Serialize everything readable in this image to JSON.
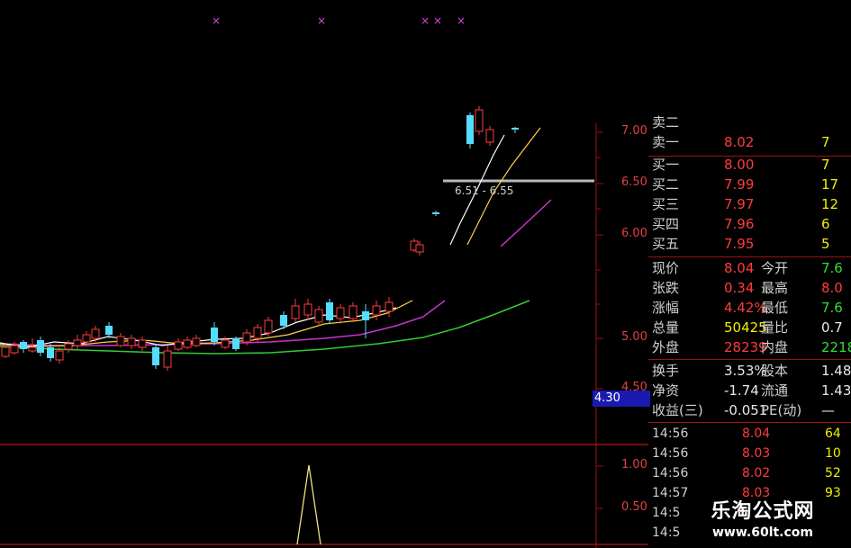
{
  "colors": {
    "up": "#ff3c3c",
    "down": "#55ddff",
    "ma5": "#ffffff",
    "ma10": "#ffd24a",
    "ma20": "#cc33cc",
    "ma60": "#33cc33",
    "grid": "#a01010"
  },
  "signal_icons": [
    "x-mark-icon",
    "x-mark-icon",
    "x-mark-icon",
    "x-mark-icon",
    "x-mark-icon"
  ],
  "signal_glyph": "×",
  "price_axis": [
    "7.00",
    "6.50",
    "6.00",
    "5.00",
    "4.50"
  ],
  "cursor_price": "4.30",
  "price_tip": "6.51 - 6.55",
  "indicator_axis": [
    "1.00",
    "0.50"
  ],
  "panel": {
    "sell_rows": [
      {
        "label": "卖二",
        "price": "",
        "vol": ""
      },
      {
        "label": "卖一",
        "price": "8.02",
        "vol": "7"
      }
    ],
    "buy_rows": [
      {
        "label": "买一",
        "price": "8.00",
        "vol": "7"
      },
      {
        "label": "买二",
        "price": "7.99",
        "vol": "17"
      },
      {
        "label": "买三",
        "price": "7.97",
        "vol": "12"
      },
      {
        "label": "买四",
        "price": "7.96",
        "vol": "6"
      },
      {
        "label": "买五",
        "price": "7.95",
        "vol": "5"
      }
    ],
    "quote_rows": [
      {
        "l1": "现价",
        "v1": "8.04",
        "l2": "今开",
        "v2": "7.6"
      },
      {
        "l1": "张跌",
        "v1": "0.34",
        "l2": "最高",
        "v2": "8.0"
      },
      {
        "l1": "涨幅",
        "v1": "4.42%",
        "l2": "最低",
        "v2": "7.6"
      },
      {
        "l1": "总量",
        "v1": "50425",
        "l2": "量比",
        "v2": "0.7"
      },
      {
        "l1": "外盘",
        "v1": "28239",
        "l2": "内盘",
        "v2": "2218"
      }
    ],
    "finance_rows": [
      {
        "l1": "换手",
        "v1": "3.53%",
        "l2": "股本",
        "v2": "1.48"
      },
      {
        "l1": "净资",
        "v1": "-1.74",
        "l2": "流通",
        "v2": "1.43"
      },
      {
        "l1": "收益(三)",
        "v1": "-0.051",
        "l2": "PE(动)",
        "v2": "—"
      }
    ],
    "ticks": [
      {
        "time": "14:56",
        "price": "8.04",
        "vol": "64"
      },
      {
        "time": "14:56",
        "price": "8.03",
        "vol": "10"
      },
      {
        "time": "14:56",
        "price": "8.02",
        "vol": "52"
      },
      {
        "time": "14:57",
        "price": "8.03",
        "vol": "93"
      },
      {
        "time": "14:5",
        "price": "",
        "vol": ""
      },
      {
        "time": "14:5",
        "price": "",
        "vol": ""
      }
    ]
  },
  "watermark": {
    "title": "乐淘公式网",
    "url": "www.60lt.com"
  }
}
